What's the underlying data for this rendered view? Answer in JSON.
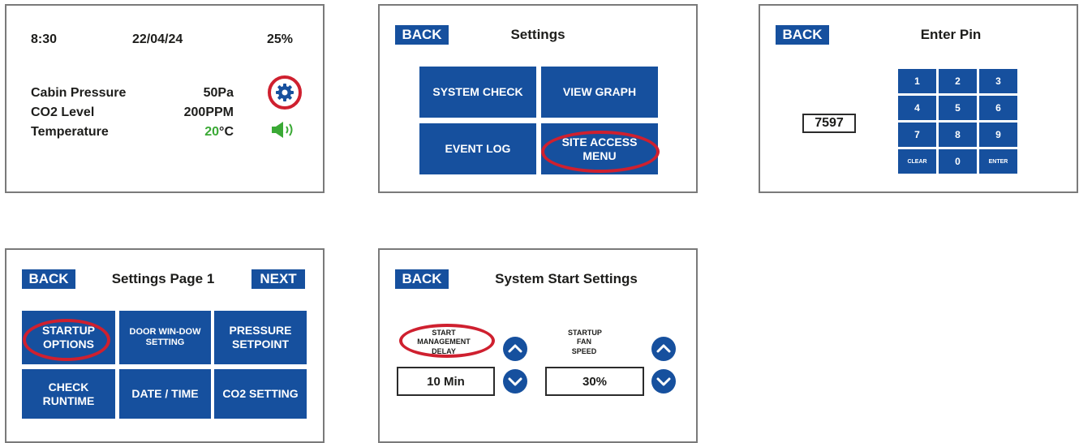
{
  "colors": {
    "accent_blue": "#16509e",
    "highlight_red": "#cf202f",
    "ok_green": "#3aa935"
  },
  "status_screen": {
    "time": "8:30",
    "date": "22/04/24",
    "battery": "25%",
    "readings": [
      {
        "label": "Cabin Pressure",
        "value": "50Pa"
      },
      {
        "label": "CO2 Level",
        "value": "200PPM"
      },
      {
        "label": "Temperature",
        "value_highlight": "20",
        "value_unit": "°C"
      }
    ],
    "icons": [
      "gear-icon",
      "speaker-icon"
    ]
  },
  "settings_screen": {
    "back_label": "BACK",
    "title": "Settings",
    "tiles": [
      "SYSTEM CHECK",
      "VIEW GRAPH",
      "EVENT LOG",
      "SITE ACCESS MENU"
    ]
  },
  "pin_screen": {
    "back_label": "BACK",
    "title": "Enter Pin",
    "pin_value": "7597",
    "keys": [
      "1",
      "2",
      "3",
      "4",
      "5",
      "6",
      "7",
      "8",
      "9",
      "CLEAR",
      "0",
      "ENTER"
    ]
  },
  "settings_page1_screen": {
    "back_label": "BACK",
    "title": "Settings Page 1",
    "next_label": "NEXT",
    "tiles": [
      "STARTUP OPTIONS",
      "DOOR WIN-DOW SETTING",
      "PRESSURE SETPOINT",
      "CHECK RUNTIME",
      "DATE / TIME",
      "CO2 SETTING"
    ]
  },
  "system_start_screen": {
    "back_label": "BACK",
    "title": "System Start Settings",
    "settings": [
      {
        "label": "START MANAGEMENT DELAY",
        "value": "10 Min"
      },
      {
        "label": "STARTUP FAN SPEED",
        "value": "30%"
      }
    ]
  }
}
